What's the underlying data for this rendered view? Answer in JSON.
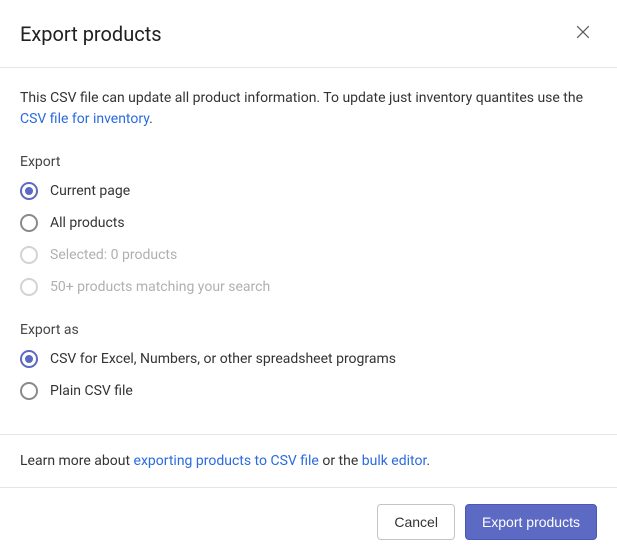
{
  "header": {
    "title": "Export products"
  },
  "intro": {
    "text_prefix": "This CSV file can update all product information. To update just inventory quantites use the ",
    "link_text": "CSV file for inventory",
    "text_suffix": "."
  },
  "export_section": {
    "label": "Export",
    "options": [
      {
        "label": "Current page",
        "selected": true,
        "disabled": false
      },
      {
        "label": "All products",
        "selected": false,
        "disabled": false
      },
      {
        "label": "Selected: 0 products",
        "selected": false,
        "disabled": true
      },
      {
        "label": "50+ products matching your search",
        "selected": false,
        "disabled": true
      }
    ]
  },
  "export_as_section": {
    "label": "Export as",
    "options": [
      {
        "label": "CSV for Excel, Numbers, or other spreadsheet programs",
        "selected": true,
        "disabled": false
      },
      {
        "label": "Plain CSV file",
        "selected": false,
        "disabled": false
      }
    ]
  },
  "learn": {
    "prefix": "Learn more about ",
    "link1": "exporting products to CSV file",
    "mid": " or the ",
    "link2": "bulk editor",
    "suffix": "."
  },
  "footer": {
    "cancel": "Cancel",
    "submit": "Export products"
  }
}
